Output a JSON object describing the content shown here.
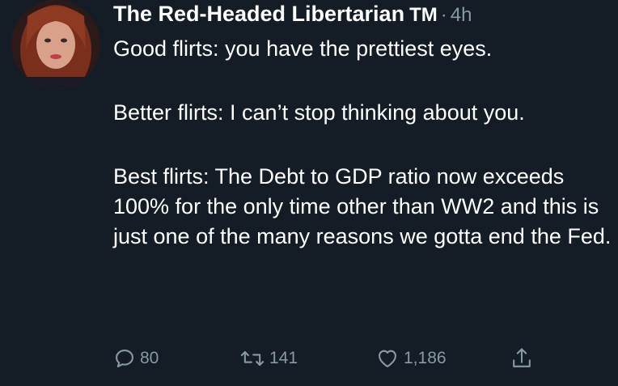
{
  "tweet": {
    "author_name": "The Red-Headed Libertarian",
    "author_badge": "TM",
    "separator": "·",
    "time": "4h",
    "paragraphs": [
      "Good flirts: you have the prettiest eyes.",
      "Better flirts: I can’t stop thinking about you.",
      "Best flirts: The Debt to GDP ratio now exceeds 100% for the only time other than WW2 and this is just one of the many reasons we gotta end the Fed."
    ]
  },
  "actions": {
    "reply_icon": "reply-icon",
    "reply_count": "80",
    "retweet_icon": "retweet-icon",
    "retweet_count": "141",
    "like_icon": "heart-icon",
    "like_count": "1,186",
    "share_icon": "share-icon"
  },
  "colors": {
    "background": "#141d26",
    "text": "#ffffff",
    "secondary": "#8899a6"
  }
}
